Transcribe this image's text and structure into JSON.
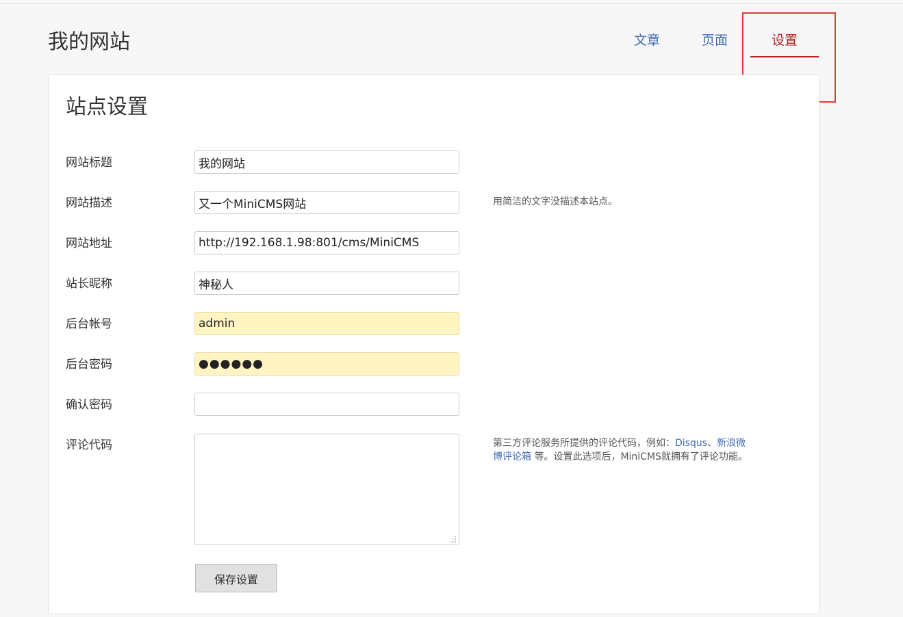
{
  "header": {
    "site_title": "我的网站",
    "nav": [
      {
        "label": "文章"
      },
      {
        "label": "页面"
      },
      {
        "label": "设置"
      }
    ],
    "active_nav_color": "#b22222",
    "nav_color": "#3f6ab6"
  },
  "page": {
    "title": "站点设置"
  },
  "form": {
    "site_title": {
      "label": "网站标题",
      "value": "我的网站"
    },
    "site_description": {
      "label": "网站描述",
      "value": "又一个MiniCMS网站",
      "hint": "用简洁的文字没描述本站点。"
    },
    "site_url": {
      "label": "网站地址",
      "value": "http://192.168.1.98:801/cms/MiniCMS"
    },
    "owner_nickname": {
      "label": "站长昵称",
      "value": "神秘人"
    },
    "admin_account": {
      "label": "后台帐号",
      "value": "admin"
    },
    "admin_password": {
      "label": "后台密码",
      "value": "●●●●●●"
    },
    "confirm_password": {
      "label": "确认密码",
      "value": ""
    },
    "comment_code": {
      "label": "评论代码",
      "value": "",
      "hint_prefix": "第三方评论服务所提供的评论代码，例如：",
      "hint_link1": "Disqus",
      "hint_sep": "、",
      "hint_link2": "新浪微博评论箱",
      "hint_suffix": " 等。设置此选项后，MiniCMS就拥有了评论功能。"
    },
    "save_label": "保存设置"
  }
}
